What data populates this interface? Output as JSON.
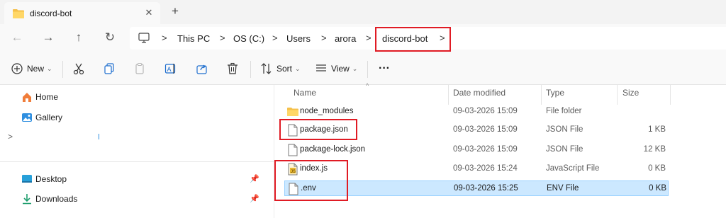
{
  "tab": {
    "title": "discord-bot",
    "close": "✕",
    "add": "+"
  },
  "nav": {
    "back": "←",
    "forward": "→",
    "up": "↑",
    "refresh": "↻",
    "breadcrumb": [
      "This PC",
      "OS (C:)",
      "Users",
      "arora",
      "discord-bot"
    ],
    "separator": ">"
  },
  "commands": {
    "new": "New",
    "sort": "Sort",
    "view": "View",
    "more": "···"
  },
  "sidebar": {
    "items": [
      {
        "label": "Home",
        "icon": "home-icon"
      },
      {
        "label": "Gallery",
        "icon": "gallery-icon"
      },
      {
        "label": "Desktop",
        "icon": "desktop-icon"
      },
      {
        "label": "Downloads",
        "icon": "downloads-icon"
      }
    ],
    "expand": ">",
    "pin": "📌"
  },
  "list": {
    "columns": [
      "Name",
      "Date modified",
      "Type",
      "Size"
    ],
    "rows": [
      {
        "name": "node_modules",
        "date": "09-03-2026 15:09",
        "type": "File folder",
        "size": "",
        "icon": "folder-icon"
      },
      {
        "name": "package.json",
        "date": "09-03-2026 15:09",
        "type": "JSON File",
        "size": "1 KB",
        "icon": "file-icon"
      },
      {
        "name": "package-lock.json",
        "date": "09-03-2026 15:09",
        "type": "JSON File",
        "size": "12 KB",
        "icon": "file-icon"
      },
      {
        "name": "index.js",
        "date": "09-03-2026 15:24",
        "type": "JavaScript File",
        "size": "0 KB",
        "icon": "js-file-icon"
      },
      {
        "name": ".env",
        "date": "09-03-2026 15:25",
        "type": "ENV File",
        "size": "0 KB",
        "icon": "file-icon"
      }
    ],
    "selected_row": ".env"
  },
  "colors": {
    "highlight": "#e01b24",
    "selection": "#cce8ff",
    "folder": "#f5c04a"
  }
}
